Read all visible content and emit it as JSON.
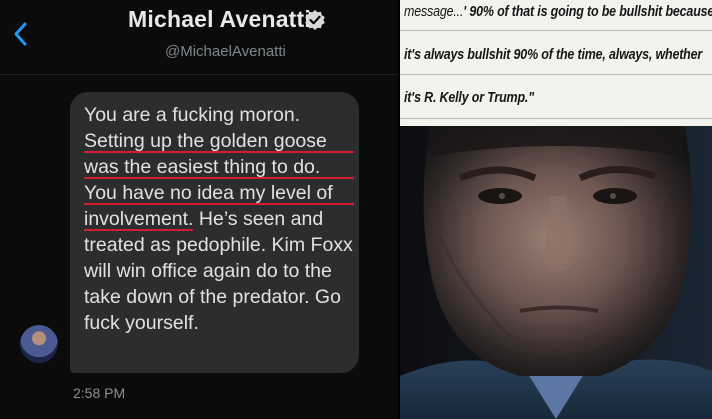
{
  "header": {
    "name": "Michael Avenatti",
    "handle": "@MichaelAvenatti"
  },
  "message": {
    "lines": [
      "You are a fucking moron.",
      "Setting up the golden goose",
      "was the easiest thing to do.",
      "You have no idea my level of",
      "involvement.",
      " He’s seen and",
      "treated as pedophile. Kim Foxx",
      "will win office again do to the",
      "take down of the predator. Go",
      "fuck yourself."
    ],
    "timestamp": "2:58 PM"
  },
  "quote": {
    "line1_start": "message...",
    "line1_bold": "' 90% of that is going to be bullshit because",
    "line2": "it's always bullshit 90% of the time, always, whether",
    "line3": "it's R. Kelly or Trump.\""
  },
  "colors": {
    "background": "#0b0b0b",
    "bubble": "#2c2d2f",
    "underline": "#cf1f2e",
    "verified": "#d9d9d9",
    "quote_bg": "#f2f2ef"
  },
  "icons": {
    "back": "chevron-left-icon",
    "verified": "verified-badge-icon"
  }
}
